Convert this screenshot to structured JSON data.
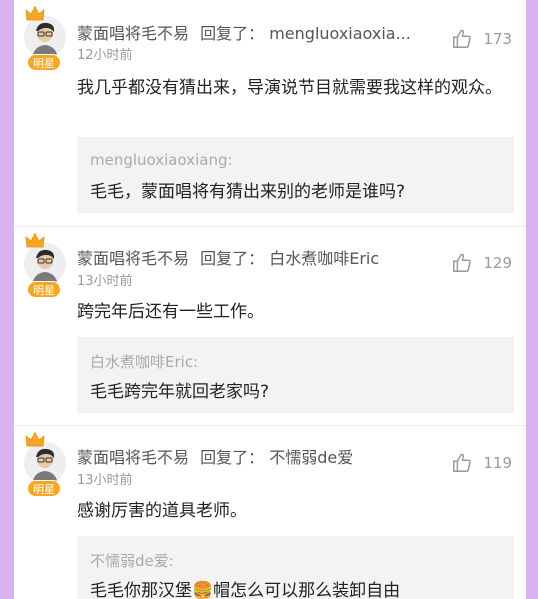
{
  "badge_label": "明星",
  "comments": [
    {
      "author": "蒙面唱将毛不易",
      "action": "回复了：",
      "reply_to": "mengluoxiaoxia...",
      "time": "12小时前",
      "likes": "173",
      "text": "我几乎都没有猜出来，导演说节目就需要我这样的观众。",
      "quote_name": "mengluoxiaoxiang:",
      "quote_text": "毛毛，蒙面唱将有猜出来别的老师是谁吗?"
    },
    {
      "author": "蒙面唱将毛不易",
      "action": "回复了：",
      "reply_to": "白水煮咖啡Eric",
      "time": "13小时前",
      "likes": "129",
      "text": "跨完年后还有一些工作。",
      "quote_name": "白水煮咖啡Eric:",
      "quote_text": "毛毛跨完年就回老家吗?"
    },
    {
      "author": "蒙面唱将毛不易",
      "action": "回复了：",
      "reply_to": "不懦弱de爱",
      "time": "13小时前",
      "likes": "119",
      "text": "感谢厉害的道具老师。",
      "quote_name": "不懦弱de爱:",
      "quote_text_before": "毛毛你那汉堡",
      "quote_text_after": "帽怎么可以那么装卸自由"
    }
  ],
  "icons": {
    "like": "thumbs-up-icon",
    "crown": "crown-icon",
    "burger": "burger-emoji"
  },
  "colors": {
    "background": "#d9b3f0",
    "badge": "#f5a623",
    "crown": "#f5a623"
  }
}
